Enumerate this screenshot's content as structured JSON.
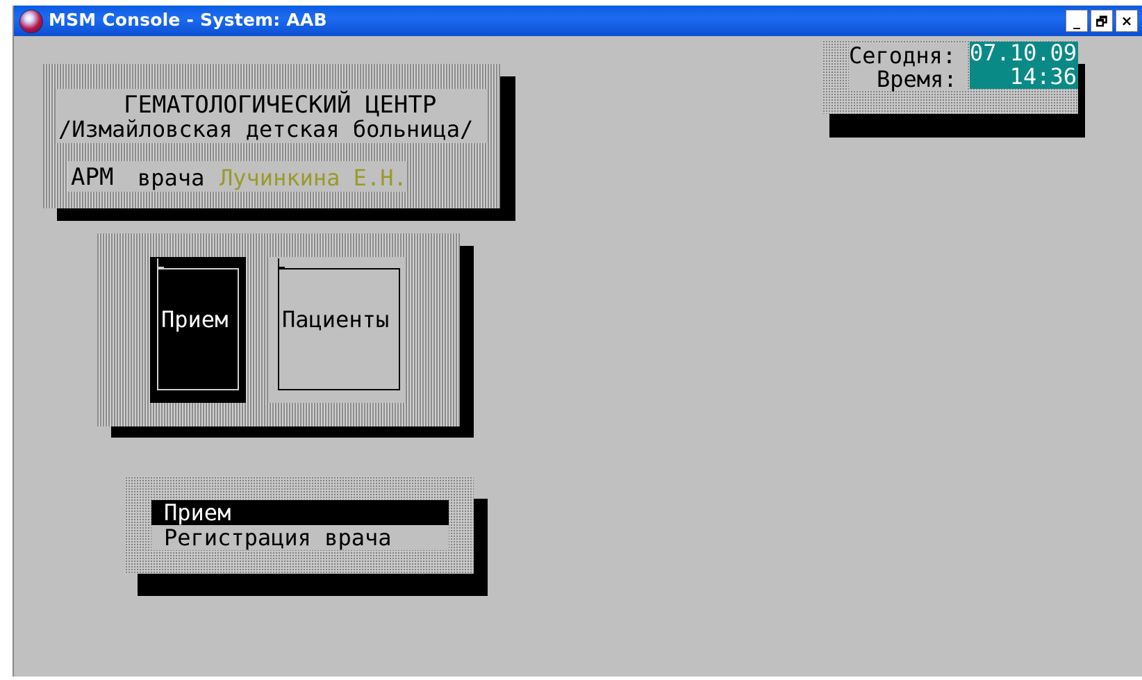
{
  "window": {
    "title": "MSM Console - System: AAB",
    "minimize_label": "_",
    "restore_label": "Ѣ",
    "close_label": "×"
  },
  "header": {
    "title_line1": "ГЕМАТОЛОГИЧЕСКИЙ ЦЕНТР",
    "title_line2": "/Измайловская детская больница/",
    "arm_label": "АРМ",
    "doctor_label": "врача",
    "doctor_name": "Лучинкина Е.Н."
  },
  "datetime": {
    "date_label": "Сегодня:",
    "date_value": "07.10.09",
    "time_label": "Время:",
    "time_value": "14:36"
  },
  "tiles": [
    {
      "label": "Прием",
      "selected": true
    },
    {
      "label": "Пациенты",
      "selected": false
    }
  ],
  "menu": {
    "items": [
      {
        "label": "Прием",
        "selected": true
      },
      {
        "label": "Регистрация врача",
        "selected": false
      }
    ]
  },
  "colors": {
    "background": "#c0c0c0",
    "title_bar": "#0b4fd2",
    "doctor_name": "#9a9a2a",
    "clock_bg": "#0a8a86"
  }
}
